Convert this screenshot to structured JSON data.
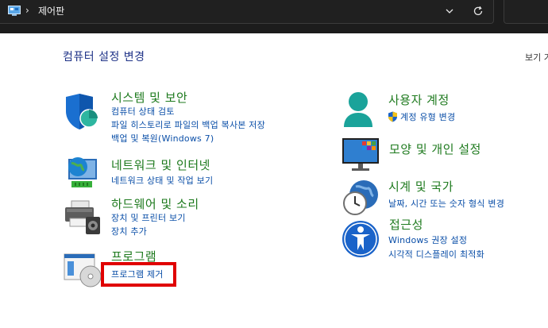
{
  "address_bar": {
    "separator": "›",
    "location": "제어판"
  },
  "header": {
    "title": "컴퓨터 설정 변경",
    "view_by": "보기 기"
  },
  "categories": {
    "system": {
      "title": "시스템 및 보안",
      "links": [
        "컴퓨터 상태 검토",
        "파일 히스토리로 파일의 백업 복사본 저장",
        "백업 및 복원(Windows 7)"
      ]
    },
    "network": {
      "title": "네트워크 및 인터넷",
      "links": [
        "네트워크 상태 및 작업 보기"
      ]
    },
    "hardware": {
      "title": "하드웨어 및 소리",
      "links": [
        "장치 및 프린터 보기",
        "장치 추가"
      ]
    },
    "programs": {
      "title": "프로그램",
      "links": [
        "프로그램 제거"
      ]
    },
    "user": {
      "title": "사용자 계정",
      "links": [
        "계정 유형 변경"
      ]
    },
    "appearance": {
      "title": "모양 및 개인 설정",
      "links": []
    },
    "clock": {
      "title": "시계 및 국가",
      "links": [
        "날짜, 시간 또는 숫자 형식 변경"
      ]
    },
    "ease": {
      "title": "접근성",
      "links": [
        "Windows 권장 설정",
        "시각적 디스플레이 최적화"
      ]
    }
  },
  "colors": {
    "category_title": "#1e7a1e",
    "link": "#0b4fa8",
    "page_title": "#1e3287",
    "highlight": "#e00000"
  },
  "icons": {
    "system": "shield-icon",
    "network": "network-globe-icon",
    "hardware": "printer-icon",
    "programs": "program-disc-icon",
    "user": "user-icon",
    "appearance": "monitor-icon",
    "clock": "clock-globe-icon",
    "ease": "accessibility-icon"
  }
}
